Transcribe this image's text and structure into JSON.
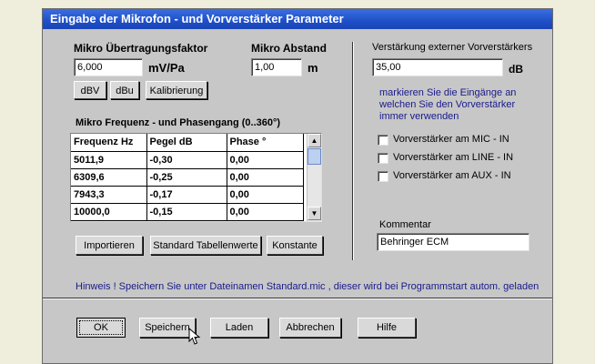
{
  "window": {
    "title": "Eingabe  der Mikrofon - und Vorverstärker Parameter"
  },
  "mikro": {
    "label": "Mikro Übertragungsfaktor",
    "value": "6,000",
    "unit": "mV/Pa",
    "buttons": {
      "dbv": "dBV",
      "dbu": "dBu",
      "kalibrierung": "Kalibrierung"
    }
  },
  "abstand": {
    "label": "Mikro Abstand",
    "value": "1,00",
    "unit": "m"
  },
  "freq": {
    "title": "Mikro  Frequenz - und  Phasengang (0..360°)",
    "columns": [
      "Frequenz Hz",
      "Pegel dB",
      "Phase °"
    ],
    "rows": [
      [
        "5011,9",
        "-0,30",
        "0,00"
      ],
      [
        "6309,6",
        "-0,25",
        "0,00"
      ],
      [
        "7943,3",
        "-0,17",
        "0,00"
      ],
      [
        "10000,0",
        "-0,15",
        "0,00"
      ]
    ],
    "buttons": {
      "importieren": "Importieren",
      "standard": "Standard Tabellenwerte",
      "konstante": "Konstante"
    }
  },
  "vorverstaerker": {
    "label": "Verstärkung externer Vorverstärkers",
    "value": "35,00",
    "unit": "dB",
    "hint_lines": [
      "markieren Sie die Eingänge an",
      "welchen Sie den Vorverstärker",
      "immer verwenden"
    ],
    "checkboxes": [
      {
        "label": "Vorverstärker am MIC  - IN",
        "checked": false
      },
      {
        "label": "Vorverstärker am LINE - IN",
        "checked": false
      },
      {
        "label": "Vorverstärker am AUX  - IN",
        "checked": false
      }
    ]
  },
  "kommentar": {
    "label": "Kommentar",
    "value": "Behringer ECM"
  },
  "hinweis": "Hinweis !  Speichern Sie unter Dateinamen Standard.mic , dieser wird bei Programmstart autom. geladen",
  "footer": {
    "ok": "OK",
    "speichern": "Speichern",
    "laden": "Laden",
    "abbrechen": "Abbrechen",
    "hilfe": "Hilfe"
  },
  "colors": {
    "titlebar": "#1e4fc8",
    "dialog_bg": "#c7c7c7",
    "hint_text": "#1a1a8c"
  }
}
